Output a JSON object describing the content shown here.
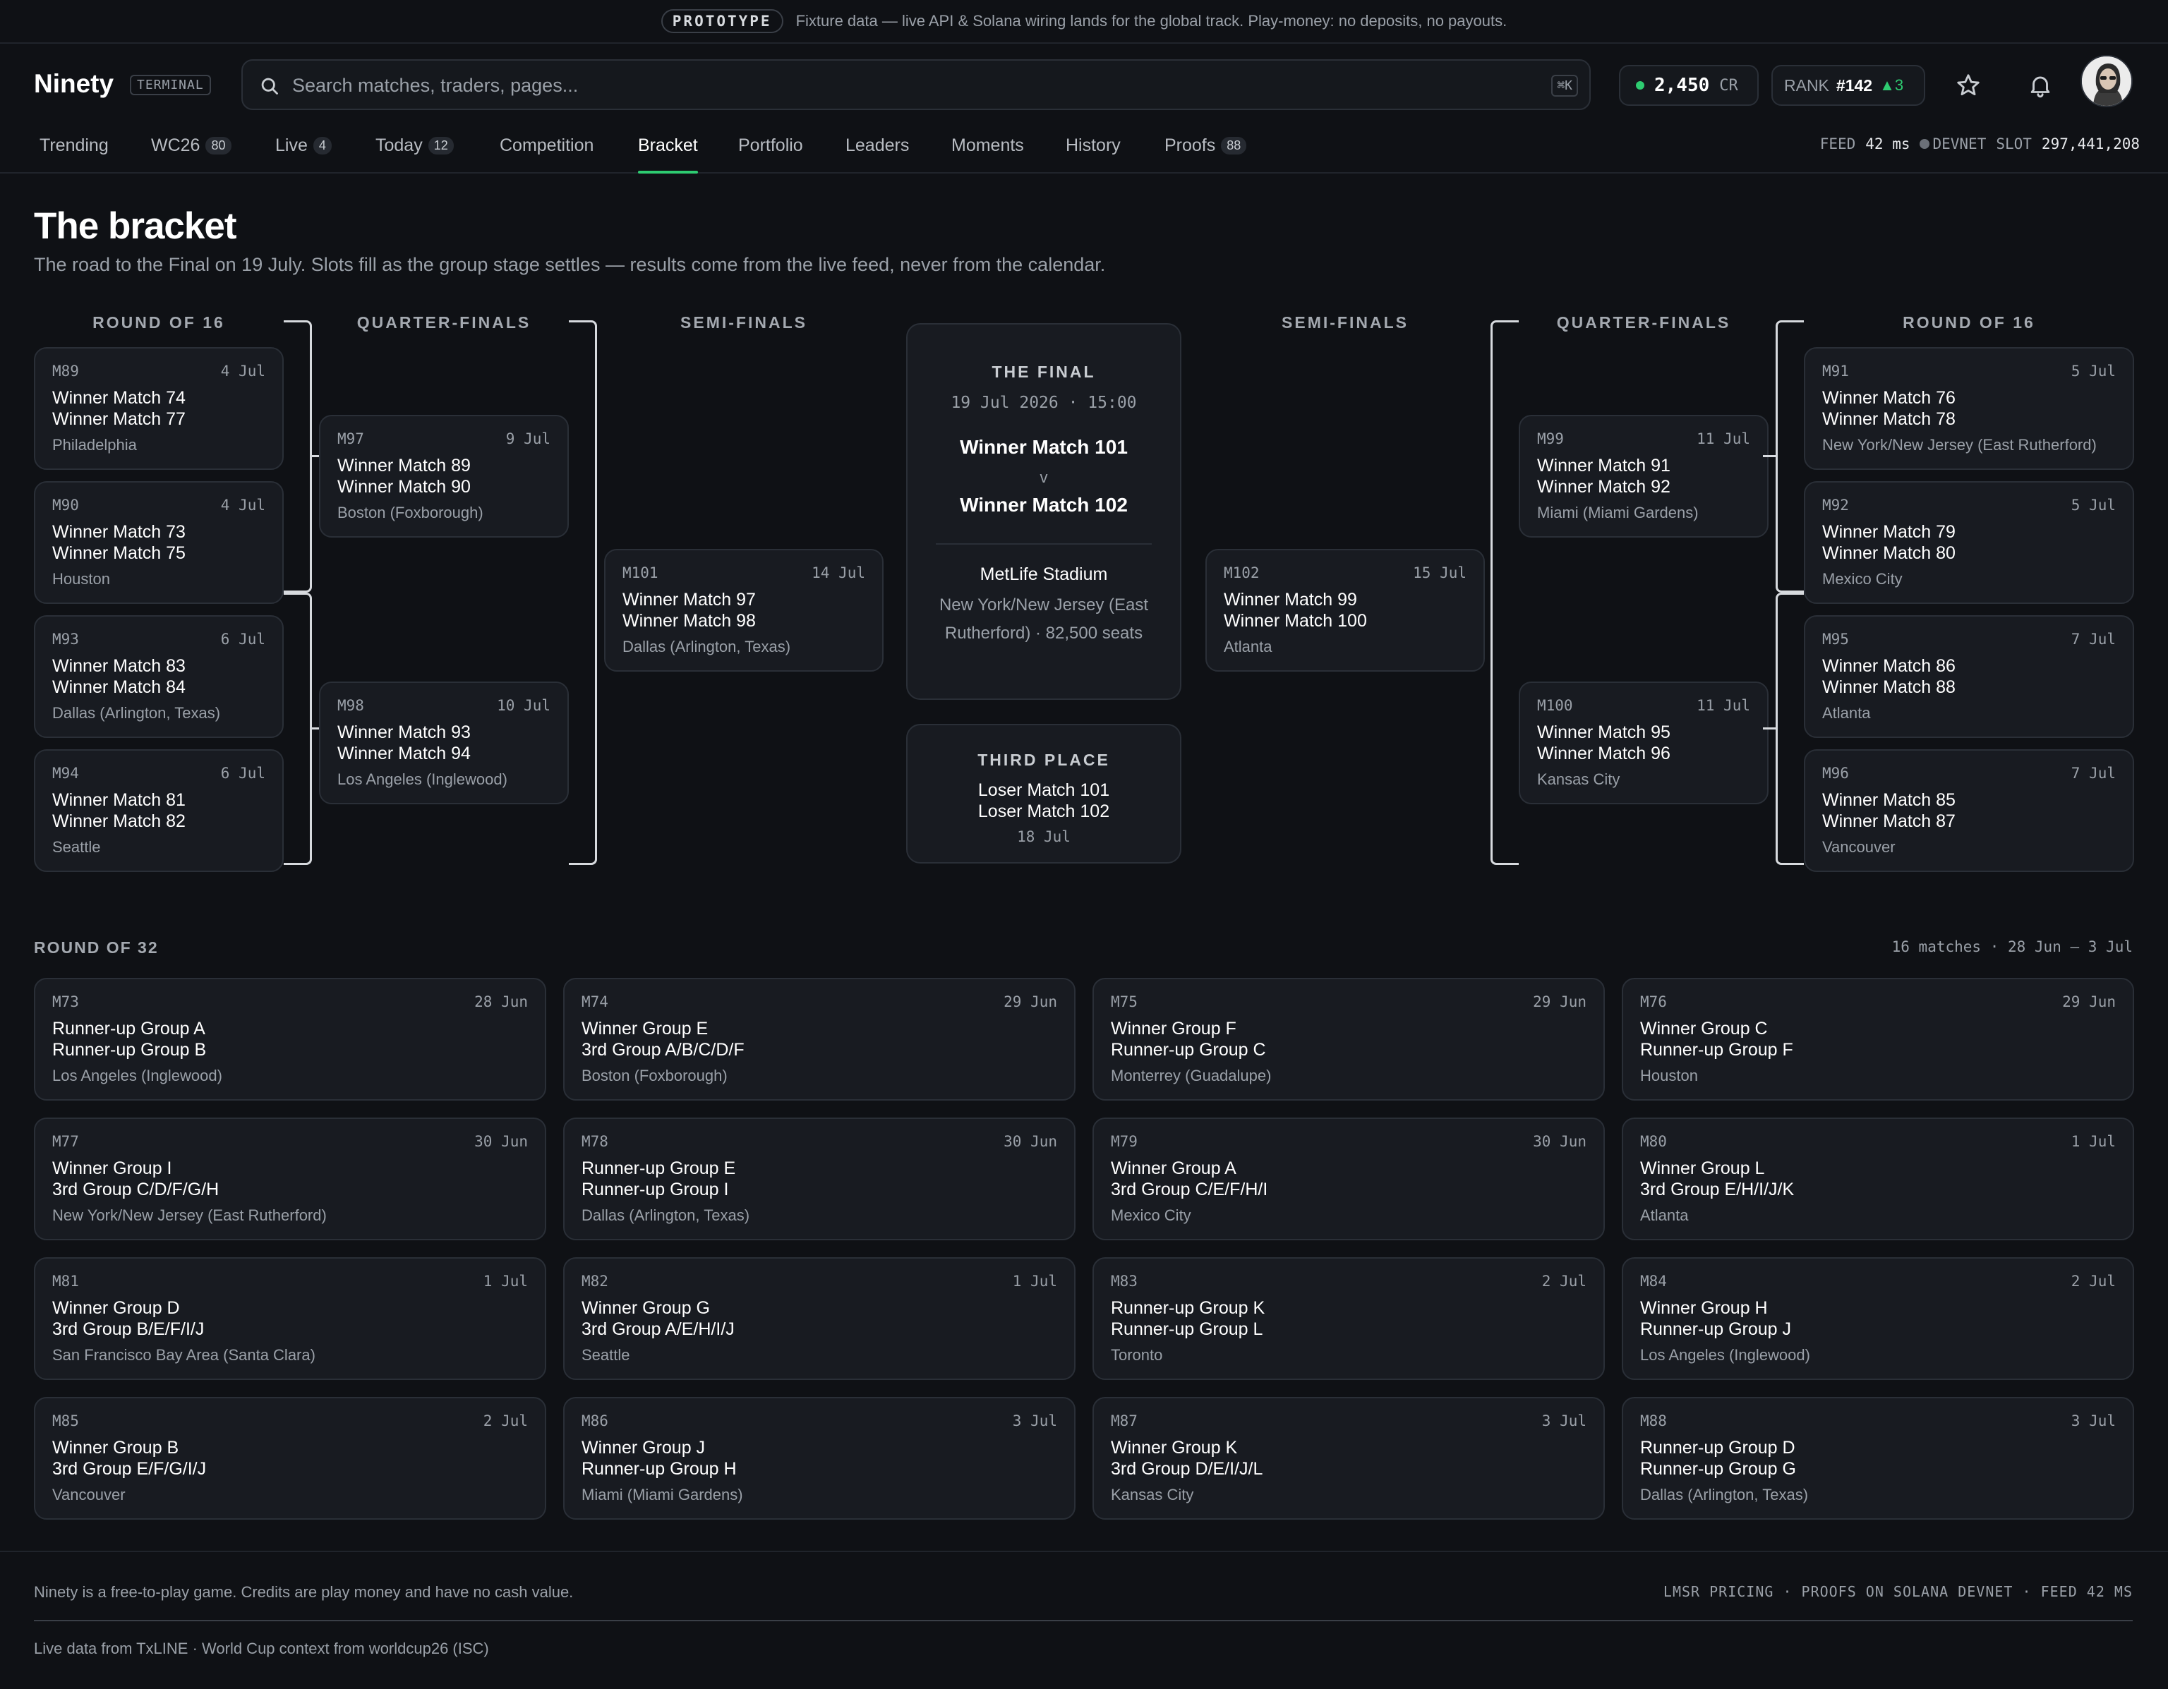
{
  "banner": {
    "pill": "PROTOTYPE",
    "text": "Fixture data — live API & Solana wiring lands for the global track. Play-money: no deposits, no payouts."
  },
  "header": {
    "logo": "Ninety",
    "logo_tag": "TERMINAL",
    "search_placeholder": "Search matches, traders, pages...",
    "search_shortcut": "⌘K",
    "credits": "2,450",
    "credits_unit": "CR",
    "rank_label": "RANK",
    "rank_value": "#142",
    "rank_change": "▲3"
  },
  "nav": {
    "items": [
      {
        "label": "Trending",
        "badge": ""
      },
      {
        "label": "WC26",
        "badge": "80"
      },
      {
        "label": "Live",
        "badge": "4"
      },
      {
        "label": "Today",
        "badge": "12"
      },
      {
        "label": "Competition",
        "badge": ""
      },
      {
        "label": "Bracket",
        "badge": ""
      },
      {
        "label": "Portfolio",
        "badge": ""
      },
      {
        "label": "Leaders",
        "badge": ""
      },
      {
        "label": "Moments",
        "badge": ""
      },
      {
        "label": "History",
        "badge": ""
      },
      {
        "label": "Proofs",
        "badge": "88"
      }
    ],
    "feed_label": "FEED",
    "feed_value": "42 ms",
    "network": "DEVNET",
    "slot_label": "SLOT",
    "slot_value": "297,441,208"
  },
  "page": {
    "title": "The bracket",
    "subtitle": "The road to the Final on 19 July. Slots fill as the group stage settles — results come from the live feed, never from the calendar."
  },
  "columns": {
    "r16": "ROUND OF 16",
    "qf": "QUARTER-FINALS",
    "sf": "SEMI-FINALS"
  },
  "left_r16": [
    {
      "id": "M89",
      "date": "4 Jul",
      "t1": "Winner Match 74",
      "t2": "Winner Match 77",
      "venue": "Philadelphia"
    },
    {
      "id": "M90",
      "date": "4 Jul",
      "t1": "Winner Match 73",
      "t2": "Winner Match 75",
      "venue": "Houston"
    },
    {
      "id": "M93",
      "date": "6 Jul",
      "t1": "Winner Match 83",
      "t2": "Winner Match 84",
      "venue": "Dallas (Arlington, Texas)"
    },
    {
      "id": "M94",
      "date": "6 Jul",
      "t1": "Winner Match 81",
      "t2": "Winner Match 82",
      "venue": "Seattle"
    }
  ],
  "left_qf": [
    {
      "id": "M97",
      "date": "9 Jul",
      "t1": "Winner Match 89",
      "t2": "Winner Match 90",
      "venue": "Boston (Foxborough)"
    },
    {
      "id": "M98",
      "date": "10 Jul",
      "t1": "Winner Match 93",
      "t2": "Winner Match 94",
      "venue": "Los Angeles (Inglewood)"
    }
  ],
  "left_sf": {
    "id": "M101",
    "date": "14 Jul",
    "t1": "Winner Match 97",
    "t2": "Winner Match 98",
    "venue": "Dallas (Arlington, Texas)"
  },
  "right_sf": {
    "id": "M102",
    "date": "15 Jul",
    "t1": "Winner Match 99",
    "t2": "Winner Match 100",
    "venue": "Atlanta"
  },
  "right_qf": [
    {
      "id": "M99",
      "date": "11 Jul",
      "t1": "Winner Match 91",
      "t2": "Winner Match 92",
      "venue": "Miami (Miami Gardens)"
    },
    {
      "id": "M100",
      "date": "11 Jul",
      "t1": "Winner Match 95",
      "t2": "Winner Match 96",
      "venue": "Kansas City"
    }
  ],
  "right_r16": [
    {
      "id": "M91",
      "date": "5 Jul",
      "t1": "Winner Match 76",
      "t2": "Winner Match 78",
      "venue": "New York/New Jersey (East Rutherford)"
    },
    {
      "id": "M92",
      "date": "5 Jul",
      "t1": "Winner Match 79",
      "t2": "Winner Match 80",
      "venue": "Mexico City"
    },
    {
      "id": "M95",
      "date": "7 Jul",
      "t1": "Winner Match 86",
      "t2": "Winner Match 88",
      "venue": "Atlanta"
    },
    {
      "id": "M96",
      "date": "7 Jul",
      "t1": "Winner Match 85",
      "t2": "Winner Match 87",
      "venue": "Vancouver"
    }
  ],
  "final": {
    "label": "THE FINAL",
    "date": "19 Jul 2026 · 15:00",
    "t1": "Winner Match 101",
    "vs": "v",
    "t2": "Winner Match 102",
    "stadium": "MetLife Stadium",
    "location": "New York/New Jersey (East Rutherford) · 82,500 seats"
  },
  "third": {
    "label": "THIRD PLACE",
    "t1": "Loser Match 101",
    "t2": "Loser Match 102",
    "date": "18 Jul"
  },
  "r32": {
    "title": "ROUND OF 32",
    "meta": "16 matches · 28 Jun – 3 Jul",
    "matches": [
      {
        "id": "M73",
        "date": "28 Jun",
        "t1": "Runner-up Group A",
        "t2": "Runner-up Group B",
        "venue": "Los Angeles (Inglewood)"
      },
      {
        "id": "M74",
        "date": "29 Jun",
        "t1": "Winner Group E",
        "t2": "3rd Group A/B/C/D/F",
        "venue": "Boston (Foxborough)"
      },
      {
        "id": "M75",
        "date": "29 Jun",
        "t1": "Winner Group F",
        "t2": "Runner-up Group C",
        "venue": "Monterrey (Guadalupe)"
      },
      {
        "id": "M76",
        "date": "29 Jun",
        "t1": "Winner Group C",
        "t2": "Runner-up Group F",
        "venue": "Houston"
      },
      {
        "id": "M77",
        "date": "30 Jun",
        "t1": "Winner Group I",
        "t2": "3rd Group C/D/F/G/H",
        "venue": "New York/New Jersey (East Rutherford)"
      },
      {
        "id": "M78",
        "date": "30 Jun",
        "t1": "Runner-up Group E",
        "t2": "Runner-up Group I",
        "venue": "Dallas (Arlington, Texas)"
      },
      {
        "id": "M79",
        "date": "30 Jun",
        "t1": "Winner Group A",
        "t2": "3rd Group C/E/F/H/I",
        "venue": "Mexico City"
      },
      {
        "id": "M80",
        "date": "1 Jul",
        "t1": "Winner Group L",
        "t2": "3rd Group E/H/I/J/K",
        "venue": "Atlanta"
      },
      {
        "id": "M81",
        "date": "1 Jul",
        "t1": "Winner Group D",
        "t2": "3rd Group B/E/F/I/J",
        "venue": "San Francisco Bay Area (Santa Clara)"
      },
      {
        "id": "M82",
        "date": "1 Jul",
        "t1": "Winner Group G",
        "t2": "3rd Group A/E/H/I/J",
        "venue": "Seattle"
      },
      {
        "id": "M83",
        "date": "2 Jul",
        "t1": "Runner-up Group K",
        "t2": "Runner-up Group L",
        "venue": "Toronto"
      },
      {
        "id": "M84",
        "date": "2 Jul",
        "t1": "Winner Group H",
        "t2": "Runner-up Group J",
        "venue": "Los Angeles (Inglewood)"
      },
      {
        "id": "M85",
        "date": "2 Jul",
        "t1": "Winner Group B",
        "t2": "3rd Group E/F/G/I/J",
        "venue": "Vancouver"
      },
      {
        "id": "M86",
        "date": "3 Jul",
        "t1": "Winner Group J",
        "t2": "Runner-up Group H",
        "venue": "Miami (Miami Gardens)"
      },
      {
        "id": "M87",
        "date": "3 Jul",
        "t1": "Winner Group K",
        "t2": "3rd Group D/E/I/J/L",
        "venue": "Kansas City"
      },
      {
        "id": "M88",
        "date": "3 Jul",
        "t1": "Runner-up Group D",
        "t2": "Runner-up Group G",
        "venue": "Dallas (Arlington, Texas)"
      }
    ]
  },
  "footer": {
    "disclaimer": "Ninety is a free-to-play game. Credits are play money and have no cash value.",
    "tech": "LMSR PRICING · PROOFS ON SOLANA DEVNET · FEED 42 MS",
    "credits": "Live data from TxLINE · World Cup context from worldcup26 (ISC)"
  },
  "colors": {
    "accent": "#2ecc71",
    "background": "#0f1115",
    "card": "#181b21",
    "border": "#2a2f37"
  },
  "icons": [
    "search-icon",
    "star-icon",
    "bell-icon",
    "avatar"
  ]
}
